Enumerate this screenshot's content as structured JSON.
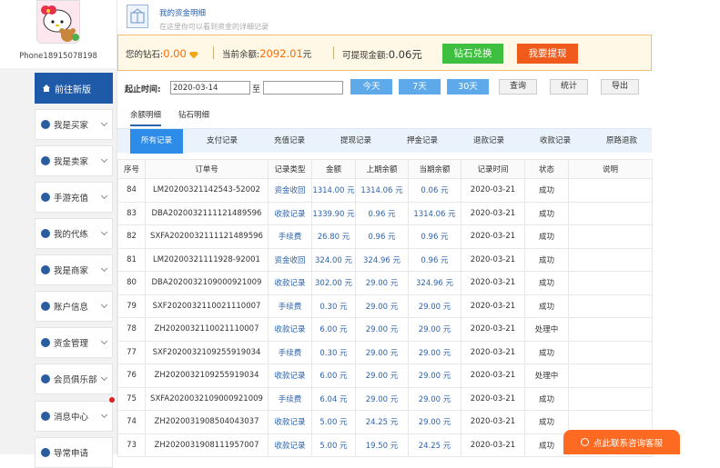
{
  "user": {
    "phone": "Phone18915078198"
  },
  "sidebar": {
    "new_version": "前往新版",
    "items": [
      {
        "label": "我是买家",
        "icon": "user-icon"
      },
      {
        "label": "我是卖家",
        "icon": "user-icon"
      },
      {
        "label": "手游充值",
        "icon": "coin-icon"
      },
      {
        "label": "我的代练",
        "icon": "gamepad-icon"
      },
      {
        "label": "我是商家",
        "icon": "shop-icon"
      },
      {
        "label": "账户信息",
        "icon": "id-card-icon"
      },
      {
        "label": "资金管理",
        "icon": "money-icon"
      },
      {
        "label": "会员俱乐部",
        "icon": "club-icon"
      },
      {
        "label": "消息中心",
        "icon": "message-icon"
      },
      {
        "label": "导常申请",
        "icon": "apply-icon"
      }
    ]
  },
  "header": {
    "title": "我的资金明细",
    "subtitle": "在这里你可以看到资金的详细记录"
  },
  "balance": {
    "diamond_label": "您的钻石:",
    "diamond_value": "0.00",
    "current_label": "当前余额:",
    "current_value": "2092.01",
    "current_unit": "元",
    "withdrawable_label": "可提现金额:",
    "withdrawable_value": "0.06元",
    "exchange_button": "钻石兑换",
    "withdraw_button": "我要提现"
  },
  "filter": {
    "label": "起止时间:",
    "start_date": "2020-03-14",
    "to": "至",
    "end_date": "",
    "btn_today": "今天",
    "btn_7days": "7天",
    "btn_30days": "30天",
    "btn_query": "查询",
    "btn_stats": "统计",
    "btn_export": "导出"
  },
  "subtabs": [
    "余额明细",
    "钻石明细"
  ],
  "type_tabs": [
    "所有记录",
    "支付记录",
    "充值记录",
    "提现记录",
    "押金记录",
    "退款记录",
    "收款记录",
    "原路退款"
  ],
  "table": {
    "columns": [
      "序号",
      "订单号",
      "记录类型",
      "金额",
      "上期余额",
      "当期余额",
      "记录时间",
      "状态",
      "说明"
    ],
    "rows": [
      [
        "84",
        "LM20200321142543-52002",
        "资金收回",
        "1314.00 元",
        "1314.06 元",
        "0.06 元",
        "2020-03-21",
        "成功",
        ""
      ],
      [
        "83",
        "DBA2020032111121489596",
        "收款记录",
        "1339.90 元",
        "0.96 元",
        "1314.06 元",
        "2020-03-21",
        "成功",
        ""
      ],
      [
        "82",
        "SXFA2020032111121489596",
        "手续费",
        "26.80 元",
        "0.96 元",
        "0.96 元",
        "2020-03-21",
        "成功",
        ""
      ],
      [
        "81",
        "LM20200321111928-92001",
        "资金收回",
        "324.00 元",
        "324.96 元",
        "0.96 元",
        "2020-03-21",
        "成功",
        ""
      ],
      [
        "80",
        "DBA2020032109000921009",
        "收款记录",
        "302.00 元",
        "29.00 元",
        "324.96 元",
        "2020-03-21",
        "成功",
        ""
      ],
      [
        "79",
        "SXF2020032110021110007",
        "手续费",
        "0.30 元",
        "29.00 元",
        "29.00 元",
        "2020-03-21",
        "成功",
        ""
      ],
      [
        "78",
        "ZH2020032110021110007",
        "收款记录",
        "6.00 元",
        "29.00 元",
        "29.00 元",
        "2020-03-21",
        "处理中",
        ""
      ],
      [
        "77",
        "SXF2020032109255919034",
        "手续费",
        "0.30 元",
        "29.00 元",
        "29.00 元",
        "2020-03-21",
        "成功",
        ""
      ],
      [
        "76",
        "ZH2020032109255919034",
        "收款记录",
        "6.00 元",
        "29.00 元",
        "29.00 元",
        "2020-03-21",
        "处理中",
        ""
      ],
      [
        "75",
        "SXFA2020032109000921009",
        "手续费",
        "6.04 元",
        "29.00 元",
        "29.00 元",
        "2020-03-21",
        "成功",
        ""
      ],
      [
        "74",
        "ZH2020031908504043037",
        "收款记录",
        "5.00 元",
        "24.25 元",
        "29.00 元",
        "2020-03-21",
        "成功",
        ""
      ],
      [
        "73",
        "ZH2020031908111957007",
        "收款记录",
        "5.00 元",
        "19.50 元",
        "24.25 元",
        "2020-03-21",
        "成功",
        ""
      ]
    ]
  },
  "consult": {
    "label": "点此联系咨询客服"
  },
  "colors": {
    "primary": "#2d63ad",
    "accent": "#ff6a00",
    "green": "#3fbf3f",
    "orange": "#f05a1a",
    "tab_blue": "#2d8ce8"
  }
}
